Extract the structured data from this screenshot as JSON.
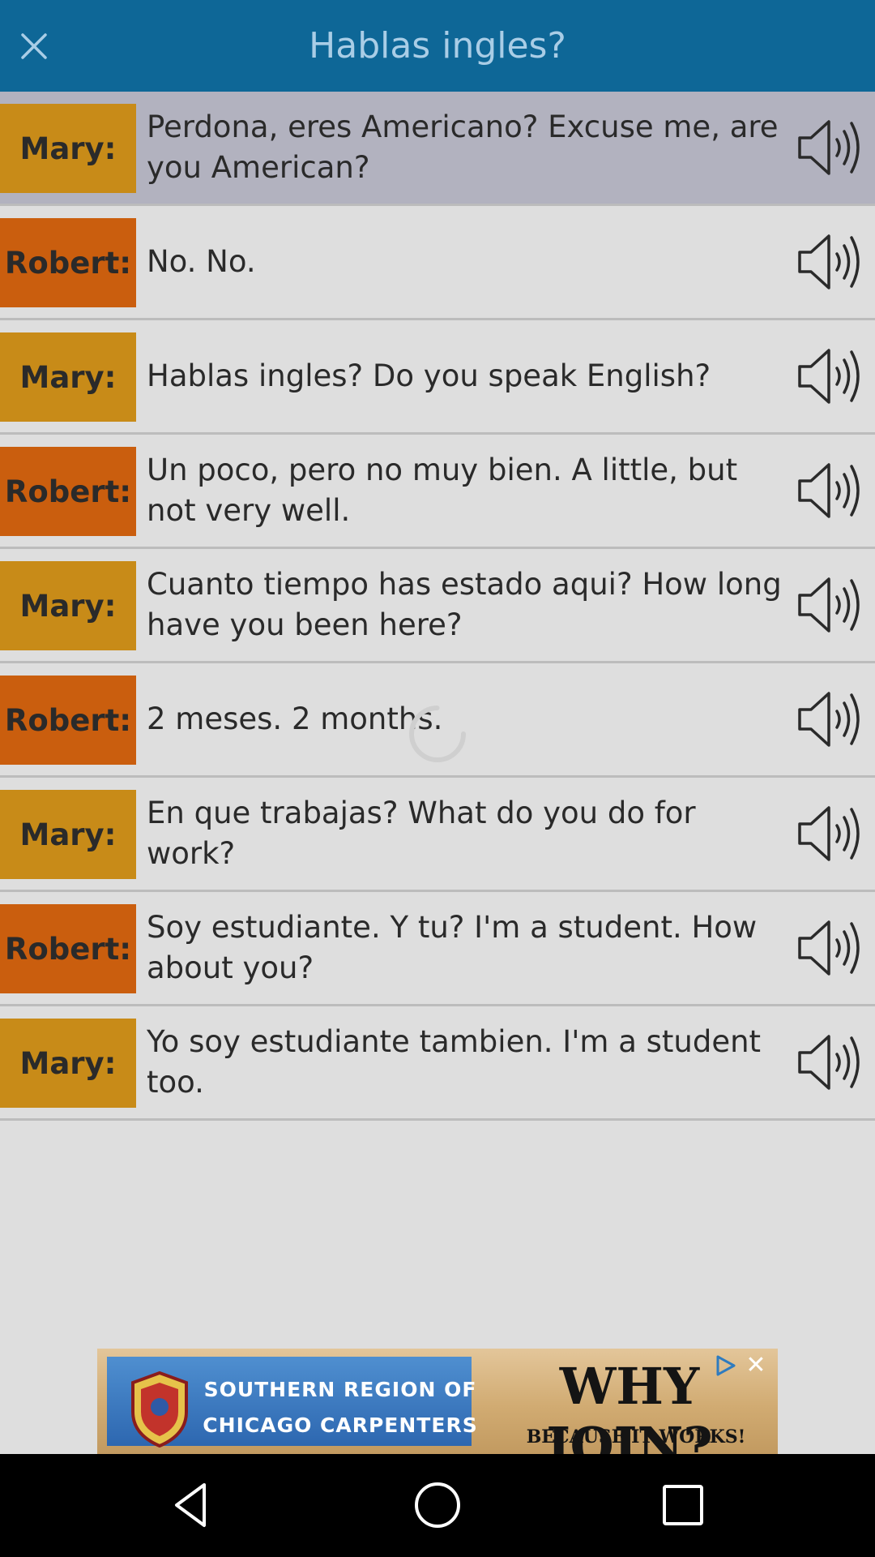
{
  "header": {
    "title": "Hablas ingles?",
    "close_icon": "close-icon"
  },
  "dialogue": [
    {
      "speaker": "Mary:",
      "text": "Perdona, eres Americano? Excuse me, are you American?"
    },
    {
      "speaker": "Robert:",
      "text": "No. No."
    },
    {
      "speaker": "Mary:",
      "text": "Hablas ingles? Do you speak English?"
    },
    {
      "speaker": "Robert:",
      "text": "Un poco, pero no muy bien. A little, but not very well."
    },
    {
      "speaker": "Mary:",
      "text": "Cuanto tiempo has estado aqui? How long have you been here?"
    },
    {
      "speaker": "Robert:",
      "text": "2 meses. 2 months."
    },
    {
      "speaker": "Mary:",
      "text": "En que trabajas? What do you do for work?"
    },
    {
      "speaker": "Robert:",
      "text": "Soy estudiante. Y tu? I'm a student. How about you?"
    },
    {
      "speaker": "Mary:",
      "text": "Yo soy estudiante tambien. I'm a student too."
    }
  ],
  "ad": {
    "line1": "SOUTHERN REGION OF",
    "line2": "CHICAGO CARPENTERS",
    "headline": "WHY JOIN?",
    "tagline": "BECAUSE IT WORKS!",
    "close": "✕"
  },
  "colors": {
    "header": "#0e6797",
    "mary": "#c88b18",
    "robert": "#ca5e0e",
    "selected_row": "#b2b2bf"
  },
  "navbar": {
    "icons": [
      "back-icon",
      "home-icon",
      "recents-icon"
    ]
  }
}
